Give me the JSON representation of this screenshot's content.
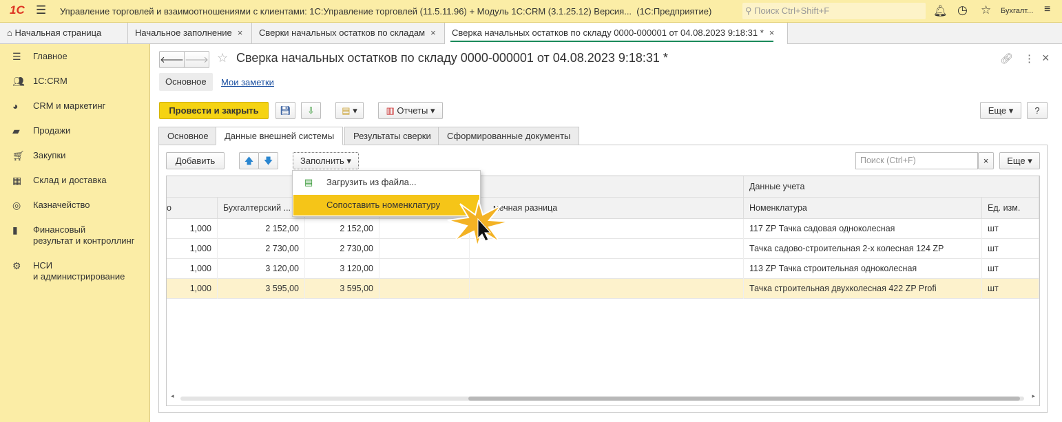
{
  "titlebar": {
    "logo": "1С",
    "title": "Управление торговлей и взаимоотношениями с клиентами: 1С:Управление торговлей (11.5.11.96) + Модуль 1С:CRM (3.1.25.12) Версия...  (1С:Предприятие)",
    "search_placeholder": "Поиск Ctrl+Shift+F",
    "user": "Бухгалт..."
  },
  "tabs": [
    {
      "label": "Начальная страница"
    },
    {
      "label": "Начальное заполнение"
    },
    {
      "label": "Сверки начальных остатков по складам"
    },
    {
      "label": "Сверка начальных остатков по складу 0000-000001 от 04.08.2023 9:18:31 *",
      "active": true
    }
  ],
  "sidebar": {
    "items": [
      {
        "label": "Главное",
        "icon": "menu-icon"
      },
      {
        "label": "1С:CRM",
        "icon": "users-icon"
      },
      {
        "label": "CRM и маркетинг",
        "icon": "pie-chart-icon"
      },
      {
        "label": "Продажи",
        "icon": "bag-icon"
      },
      {
        "label": "Закупки",
        "icon": "cart-icon"
      },
      {
        "label": "Склад и доставка",
        "icon": "grid-icon"
      },
      {
        "label": "Казначейство",
        "icon": "coins-icon"
      },
      {
        "label": "Финансовый\nрезультат и контроллинг",
        "icon": "bar-chart-icon"
      },
      {
        "label": "НСИ\nи администрирование",
        "icon": "gear-icon"
      }
    ]
  },
  "form": {
    "title": "Сверка начальных остатков по складу 0000-000001 от 04.08.2023 9:18:31 *",
    "nav_main": "Основное",
    "nav_notes": "Мои заметки",
    "post_close": "Провести и закрыть",
    "reports": "Отчеты",
    "more": "Еще",
    "help": "?",
    "tabs": [
      "Основное",
      "Данные внешней системы",
      "Результаты сверки",
      "Сформированные документы"
    ],
    "active_tab": 1,
    "add": "Добавить",
    "fill": "Заполнить",
    "search_placeholder": "Поиск (Ctrl+F)",
    "clear": "×",
    "more2": "Еще"
  },
  "menu": {
    "items": [
      "Загрузить из файла...",
      "Сопоставить номенклатуру"
    ],
    "highlighted": 1
  },
  "table": {
    "group_header": "Данные учета",
    "headers": [
      "о",
      "Бухгалтерский ...",
      "",
      "",
      "мечная разница",
      "Номенклатура",
      "Ед. изм."
    ],
    "rows": [
      {
        "qty": "1,000",
        "acc": "2 152,00",
        "sum": "2 152,00",
        "item": "117 ZP Тачка садовая одноколесная",
        "unit": "шт"
      },
      {
        "qty": "1,000",
        "acc": "2 730,00",
        "sum": "2 730,00",
        "item": "Тачка садово-строительная 2-х колесная 124 ZP",
        "unit": "шт"
      },
      {
        "qty": "1,000",
        "acc": "3 120,00",
        "sum": "3 120,00",
        "item": "113 ZP Тачка строительная одноколесная",
        "unit": "шт"
      },
      {
        "qty": "1,000",
        "acc": "3 595,00",
        "sum": "3 595,00",
        "item": "Тачка строительная двухколесная  422 ZP Profi",
        "unit": "шт",
        "selected": true
      }
    ]
  },
  "colors": {
    "accent_yellow": "#f5d313",
    "panel": "#fbeda6",
    "active_tab_underline": "#1a8a5a"
  }
}
